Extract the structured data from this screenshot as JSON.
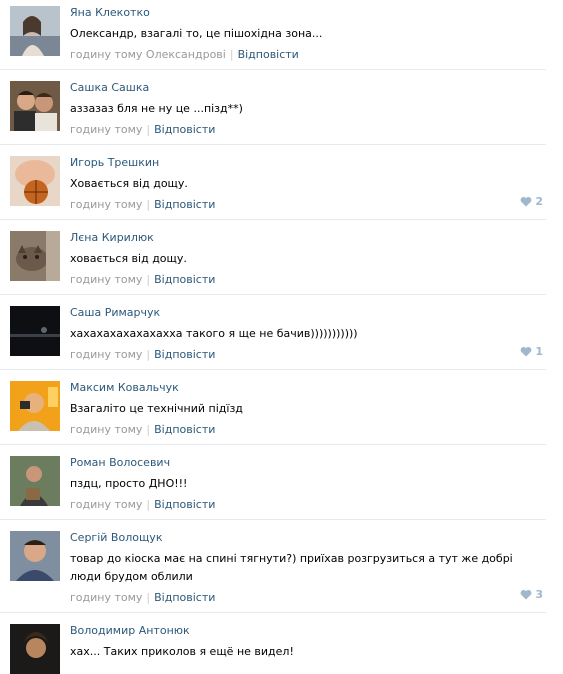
{
  "colors": {
    "link": "#2b587a",
    "meta": "#999999",
    "divider": "#e7ebf0",
    "like": "#a1b8cc"
  },
  "comments": [
    {
      "author": "Яна Клекотко",
      "text": "Олександр, взагалі то, це пішохідна зона...",
      "time": "годину тому Олександрові",
      "reply": "Відповісти",
      "likes": ""
    },
    {
      "author": "Сашка Сашка",
      "text": "аззазаз бля не ну це ...пізд**)",
      "time": "годину тому",
      "reply": "Відповісти",
      "likes": ""
    },
    {
      "author": "Игорь Трешкин",
      "text": "Ховається від дощу.",
      "time": "годину тому",
      "reply": "Відповісти",
      "likes": "2"
    },
    {
      "author": "Лєна Кирилюк",
      "text": "ховається від дощу.",
      "time": "годину тому",
      "reply": "Відповісти",
      "likes": ""
    },
    {
      "author": "Саша Римарчук",
      "text": "хахахахахахахахха такого я ще не бачив)))))))))))",
      "time": "годину тому",
      "reply": "Відповісти",
      "likes": "1"
    },
    {
      "author": "Максим Ковальчук",
      "text": "Взагаліто це технічний підїзд",
      "time": "годину тому",
      "reply": "Відповісти",
      "likes": ""
    },
    {
      "author": "Роман Волосевич",
      "text": "пздц, просто ДНО!!!",
      "time": "годину тому",
      "reply": "Відповісти",
      "likes": ""
    },
    {
      "author": "Сергій Волощук",
      "text": "товар до кіоска має на спині тягнути?) приїхав розгрузиться а тут же добрі люди брудом облили",
      "time": "годину тому",
      "reply": "Відповісти",
      "likes": "3"
    },
    {
      "author": "Володимир Антонюк",
      "text": "хах... Таких приколов я ещё не видел!",
      "time": "",
      "reply": "",
      "likes": ""
    }
  ]
}
